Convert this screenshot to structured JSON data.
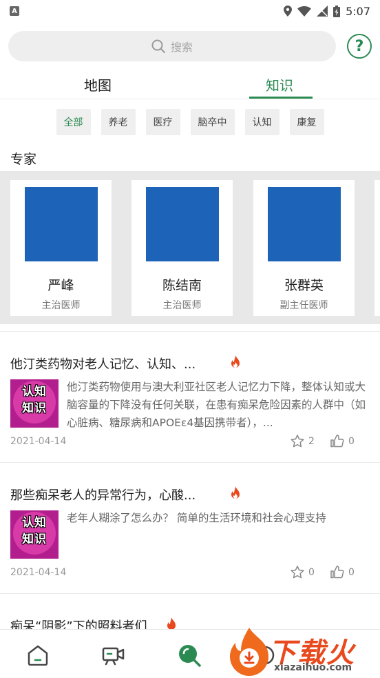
{
  "status_bar": {
    "time": "5:07",
    "left_badge": "A"
  },
  "search": {
    "placeholder": "搜索"
  },
  "tabs": [
    {
      "label": "地图",
      "active": false
    },
    {
      "label": "知识",
      "active": true
    }
  ],
  "categories": [
    "全部",
    "养老",
    "医疗",
    "脑卒中",
    "认知",
    "康复"
  ],
  "experts_section": {
    "title": "专家"
  },
  "experts": [
    {
      "name": "严峰",
      "title": "主治医师"
    },
    {
      "name": "陈结南",
      "title": "主治医师"
    },
    {
      "name": "张群英",
      "title": "副主任医师"
    }
  ],
  "articles": [
    {
      "title": "他汀类药物对老人记忆、认知、...",
      "thumb_text": "认知\n知识",
      "summary": "他汀类药物使用与澳大利亚社区老人记忆力下降，整体认知或大脑容量的下降没有任何关联，在患有痴呆危险因素的人群中（如心脏病、糖尿病和APOEε4基因携带者），...",
      "date": "2021-04-14",
      "stars": "2",
      "likes": "0"
    },
    {
      "title": "那些痴呆老人的异常行为，心酸...",
      "thumb_text": "认知\n知识",
      "summary": "老年人糊涂了怎么办？ 简单的生活环境和社会心理支持",
      "date": "2021-04-14",
      "stars": "0",
      "likes": "0"
    },
    {
      "title": "痴呆“阴影”下的照料者们"
    }
  ],
  "watermark": {
    "brand": "下载火",
    "url": "xiazaihuo.com"
  },
  "colors": {
    "accent": "#2b8a52",
    "expert_photo": "#1d63b7",
    "fire": "#e8491d"
  },
  "icons": {
    "bottom_nav": [
      "home-icon",
      "video-icon",
      "knowledge-search-icon",
      "profile-icon"
    ]
  }
}
